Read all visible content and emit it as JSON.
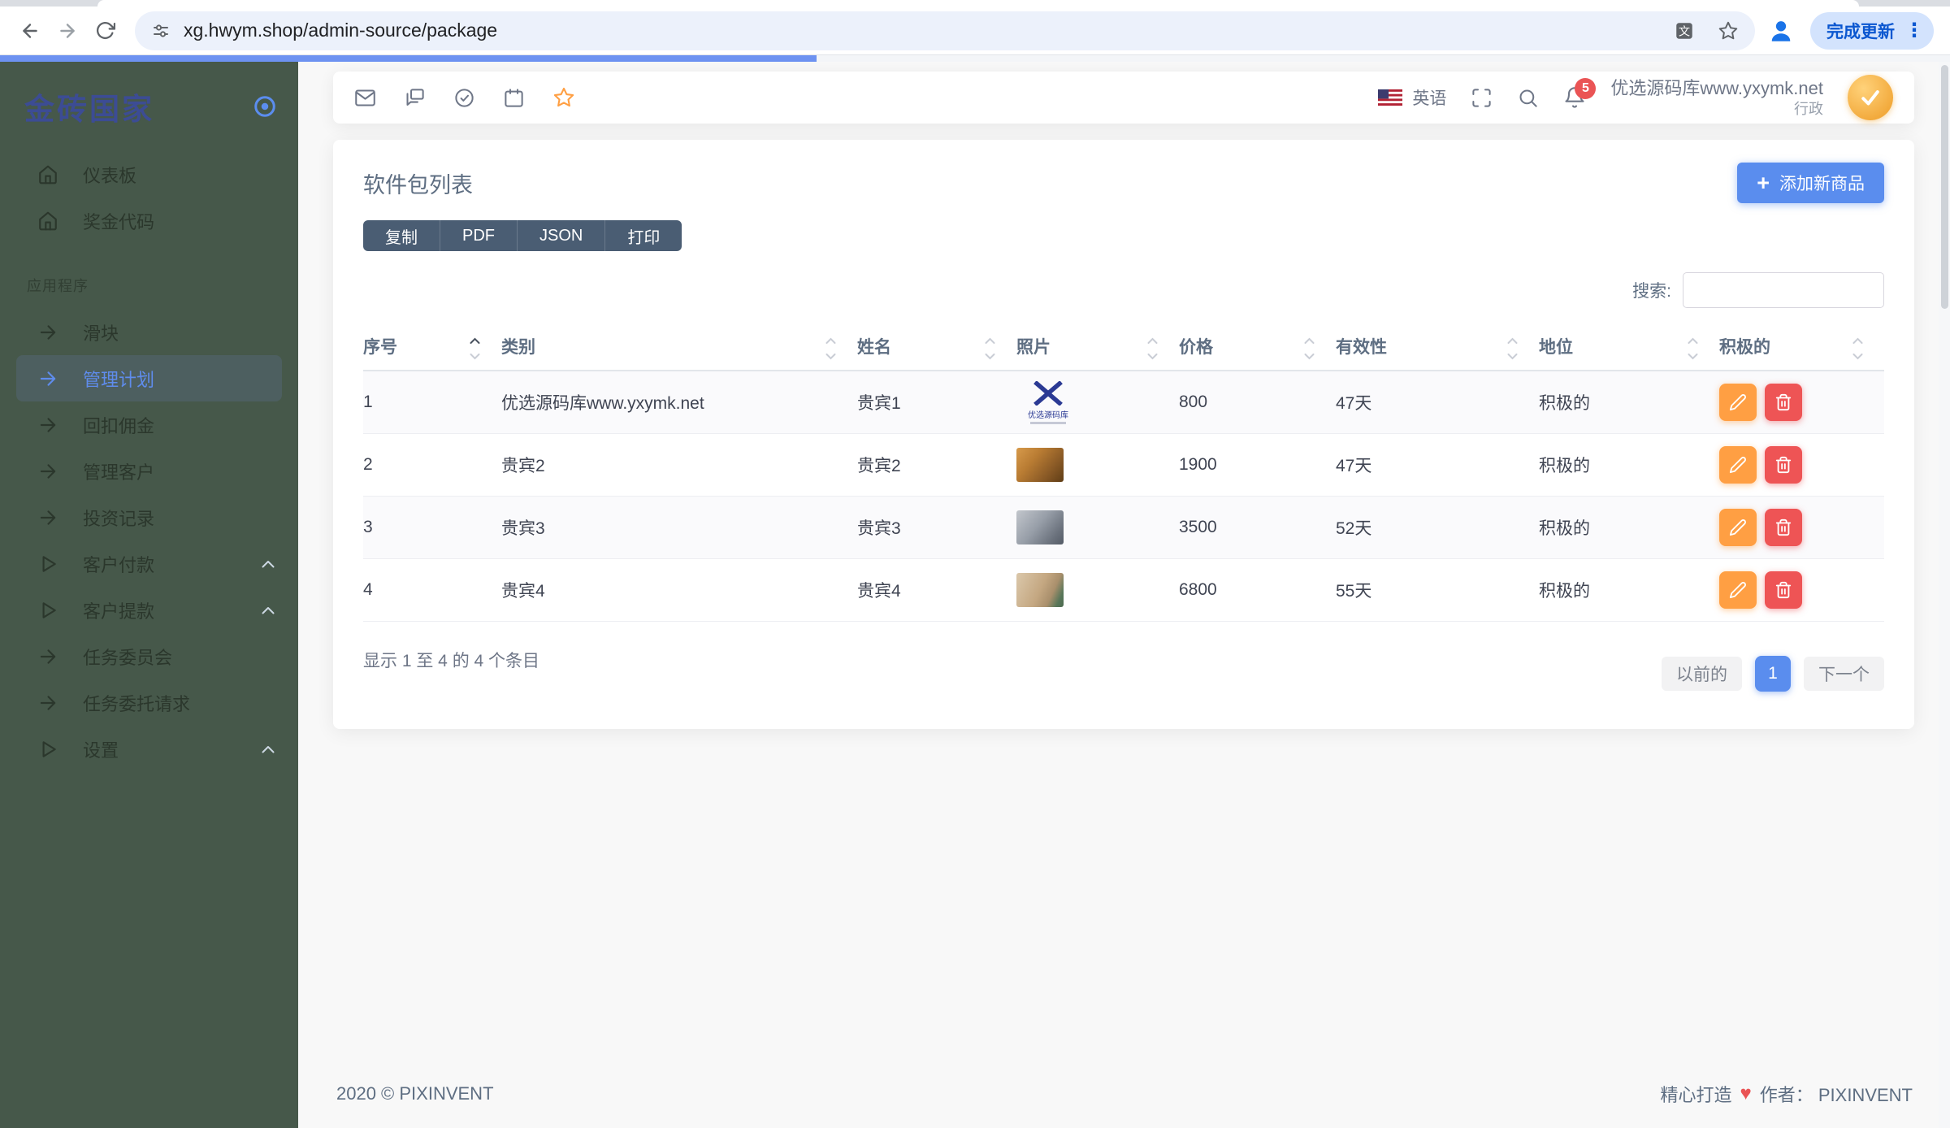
{
  "browser": {
    "url": "xg.hwym.shop/admin-source/package",
    "update_button": "完成更新"
  },
  "sidebar": {
    "brand": "金砖国家",
    "section_label": "应用程序",
    "main_items": [
      {
        "label": "仪表板",
        "icon": "home"
      },
      {
        "label": "奖金代码",
        "icon": "home"
      }
    ],
    "app_items": [
      {
        "label": "滑块",
        "icon": "arrow"
      },
      {
        "label": "管理计划",
        "icon": "arrow",
        "active": true
      },
      {
        "label": "回扣佣金",
        "icon": "arrow"
      },
      {
        "label": "管理客户",
        "icon": "arrow"
      },
      {
        "label": "投资记录",
        "icon": "arrow"
      },
      {
        "label": "客户付款",
        "icon": "play",
        "chevron": true
      },
      {
        "label": "客户提款",
        "icon": "play",
        "chevron": true
      },
      {
        "label": "任务委员会",
        "icon": "arrow"
      },
      {
        "label": "任务委托请求",
        "icon": "arrow"
      },
      {
        "label": "设置",
        "icon": "play",
        "chevron": true
      }
    ]
  },
  "navbar": {
    "language": "英语",
    "notification_count": "5",
    "user_name": "优选源码库www.yxymk.net",
    "user_role": "行政"
  },
  "content": {
    "title": "软件包列表",
    "export_buttons": [
      "复制",
      "PDF",
      "JSON",
      "打印"
    ],
    "add_button_label": "添加新商品",
    "search_label": "搜索:",
    "table": {
      "columns": [
        {
          "label": "序号",
          "sort": "asc"
        },
        {
          "label": "类别"
        },
        {
          "label": "姓名"
        },
        {
          "label": "照片"
        },
        {
          "label": "价格"
        },
        {
          "label": "有效性"
        },
        {
          "label": "地位"
        },
        {
          "label": "积极的"
        }
      ],
      "rows": [
        {
          "no": "1",
          "category": "优选源码库www.yxymk.net",
          "name": "贵宾1",
          "photo": "logo",
          "photo_label": "优选源码库",
          "price": "800",
          "validity": "47天",
          "status": "积极的"
        },
        {
          "no": "2",
          "category": "贵宾2",
          "name": "贵宾2",
          "photo": "amber",
          "price": "1900",
          "validity": "47天",
          "status": "积极的"
        },
        {
          "no": "3",
          "category": "贵宾3",
          "name": "贵宾3",
          "photo": "gray",
          "price": "3500",
          "validity": "52天",
          "status": "积极的"
        },
        {
          "no": "4",
          "category": "贵宾4",
          "name": "贵宾4",
          "photo": "beige",
          "price": "6800",
          "validity": "55天",
          "status": "积极的"
        }
      ]
    },
    "info_text": "显示 1 至 4 的 4 个条目",
    "pagination": {
      "previous": "以前的",
      "current": "1",
      "next": "下一个"
    }
  },
  "footer": {
    "copyright": "2020 © PIXINVENT",
    "made_text": "精心打造",
    "author_text": "作者： PIXINVENT"
  },
  "colors": {
    "primary": "#5A8DEE",
    "warning": "#FF9F43",
    "danger": "#EA5455",
    "sidebar_bg": "#46584A",
    "slate_text": "#5E6E82"
  }
}
